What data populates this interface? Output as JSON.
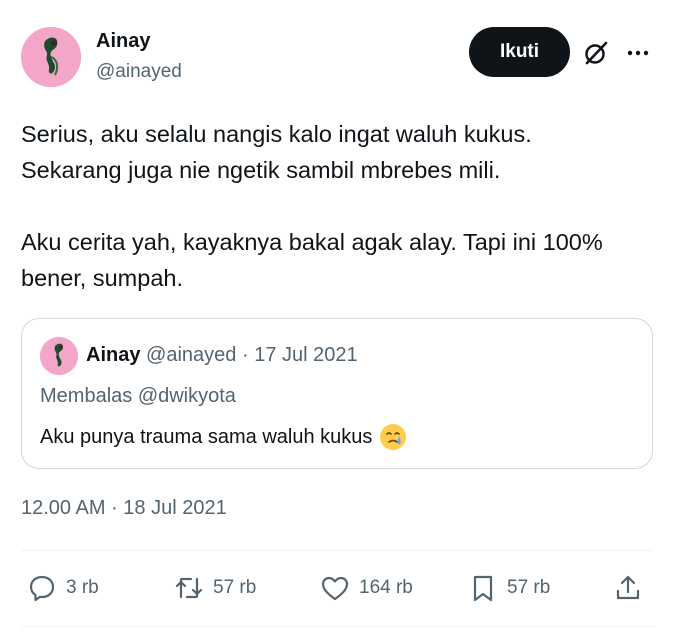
{
  "author": {
    "name": "Ainay",
    "handle": "@ainayed",
    "avatar_bg": "#f4a6c9"
  },
  "header_actions": {
    "follow_label": "Ikuti",
    "grok_icon": "grok-icon",
    "more_icon": "more-icon"
  },
  "tweet": {
    "text": "Serius, aku selalu nangis kalo ingat waluh kukus.\nSekarang juga nie ngetik sambil mbrebes mili.\n\nAku cerita yah, kayaknya bakal agak alay. Tapi ini 100% bener, sumpah.",
    "timestamp": "12.00 AM · 18 Jul 2021"
  },
  "quoted_tweet": {
    "name": "Ainay",
    "handle": "@ainayed",
    "separator": "·",
    "date": "17 Jul 2021",
    "reply_to": "Membalas @dwikyota",
    "text": "Aku punya trauma sama waluh kukus",
    "emoji": "crying-face-emoji"
  },
  "stats": {
    "replies": "3 rb",
    "retweets": "57 rb",
    "likes": "164 rb",
    "bookmarks": "57 rb"
  },
  "colors": {
    "text_primary": "#0f1419",
    "text_secondary": "#536471",
    "border": "#cfd9de",
    "follow_bg": "#0f1419"
  }
}
